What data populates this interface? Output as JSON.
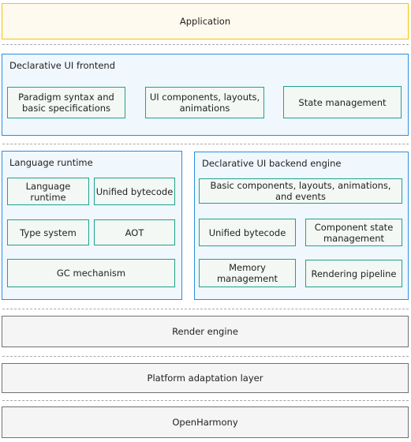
{
  "application": "Application",
  "frontend": {
    "title": "Declarative UI frontend",
    "items": [
      "Paradigm syntax and basic specifications",
      "UI components, layouts, animations",
      "State management"
    ]
  },
  "runtime": {
    "title": "Language runtime",
    "items": [
      "Language runtime",
      "Unified bytecode",
      "Type system",
      "AOT",
      "GC mechanism"
    ]
  },
  "backend": {
    "title": "Declarative UI backend engine",
    "items": [
      "Basic components, layouts, animations, and events",
      "Unified bytecode",
      "Component state management",
      "Memory management",
      "Rendering pipeline"
    ]
  },
  "render_engine": "Render engine",
  "platform": "Platform adaptation layer",
  "os": "OpenHarmony",
  "colors": {
    "app_border": "#f5c400",
    "group_border": "#2b8ee0",
    "module_border": "#1ea38b",
    "layer_border": "#707070"
  }
}
